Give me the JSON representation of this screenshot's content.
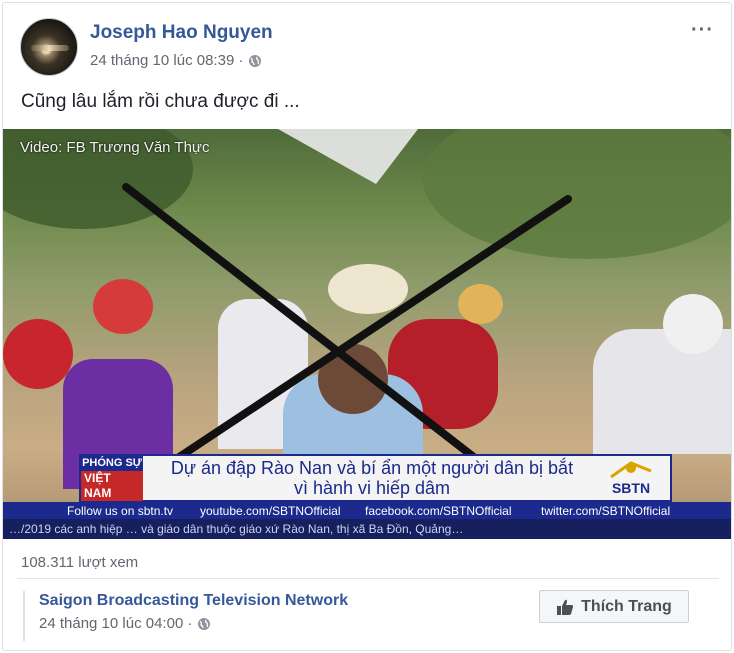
{
  "post": {
    "author": "Joseph Hao Nguyen",
    "timestamp": "24 tháng 10 lúc 08:39 ·",
    "privacy_icon": "globe-icon",
    "status_text": "Cũng lâu lắm rồi chưa được đi ...",
    "more_label": "···"
  },
  "video": {
    "credit": "Video: FB Trương Văn Thực",
    "banner_logo_line1": "PHÓNG SỰ",
    "banner_logo_line2": "VIỆT NAM",
    "headline_line1": "Dự án đập Rào Nan và bí ẩn một người dân bị bắt",
    "headline_line2": "vì hành vi hiếp dâm",
    "channel_logo": "SBTN",
    "ticker": [
      "Follow us on sbtn.tv",
      "youtube.com/SBTNOfficial",
      "facebook.com/SBTNOfficial",
      "twitter.com/SBTNOfficial"
    ],
    "crawl": "…/2019 các anh hiệp … và giáo dân thuộc giáo xứ Rào Nan, thị xã Ba Đồn, Quảng…",
    "overlay": "x-mark"
  },
  "views": "108.311 lượt xem",
  "shared_page": {
    "name": "Saigon Broadcasting Television Network",
    "timestamp": "24 tháng 10 lúc 04:00 ·",
    "like_button_label": "Thích Trang"
  }
}
